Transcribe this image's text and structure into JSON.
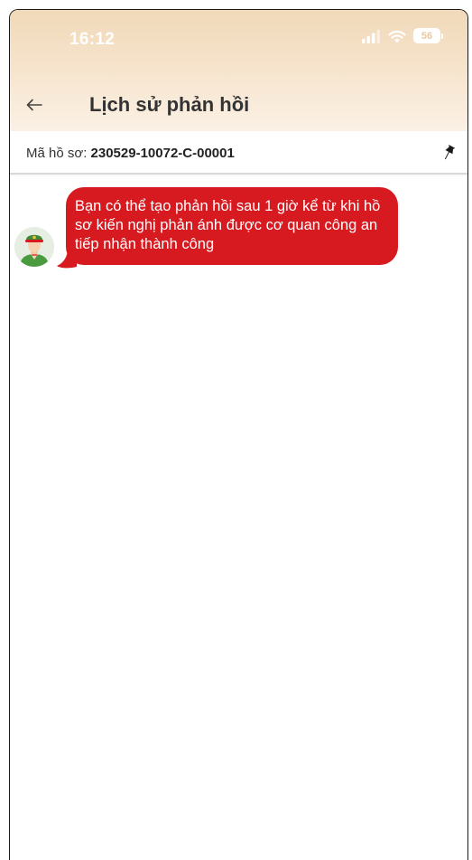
{
  "status_bar": {
    "time": "16:12",
    "battery": "56"
  },
  "header": {
    "title": "Lịch sử phản hồi"
  },
  "record": {
    "label": "Mã hồ sơ: ",
    "code": "230529-10072-C-00001"
  },
  "messages": [
    {
      "text": "Bạn có thể tạo phản hồi sau 1 giờ kể từ khi hồ sơ kiến nghị phản ánh được cơ quan công an tiếp nhận thành công"
    }
  ],
  "colors": {
    "bubble": "#d71920",
    "header_gradient_top": "#f1d9b9",
    "header_gradient_bottom": "#fbf1e5",
    "avatar_uniform": "#4a9b3f",
    "avatar_hat_band": "#d71920"
  },
  "icons": {
    "back": "arrow-left-icon",
    "pin": "pin-icon",
    "avatar": "police-officer-avatar",
    "signal": "cellular-signal-icon",
    "wifi": "wifi-icon",
    "battery": "battery-icon"
  }
}
